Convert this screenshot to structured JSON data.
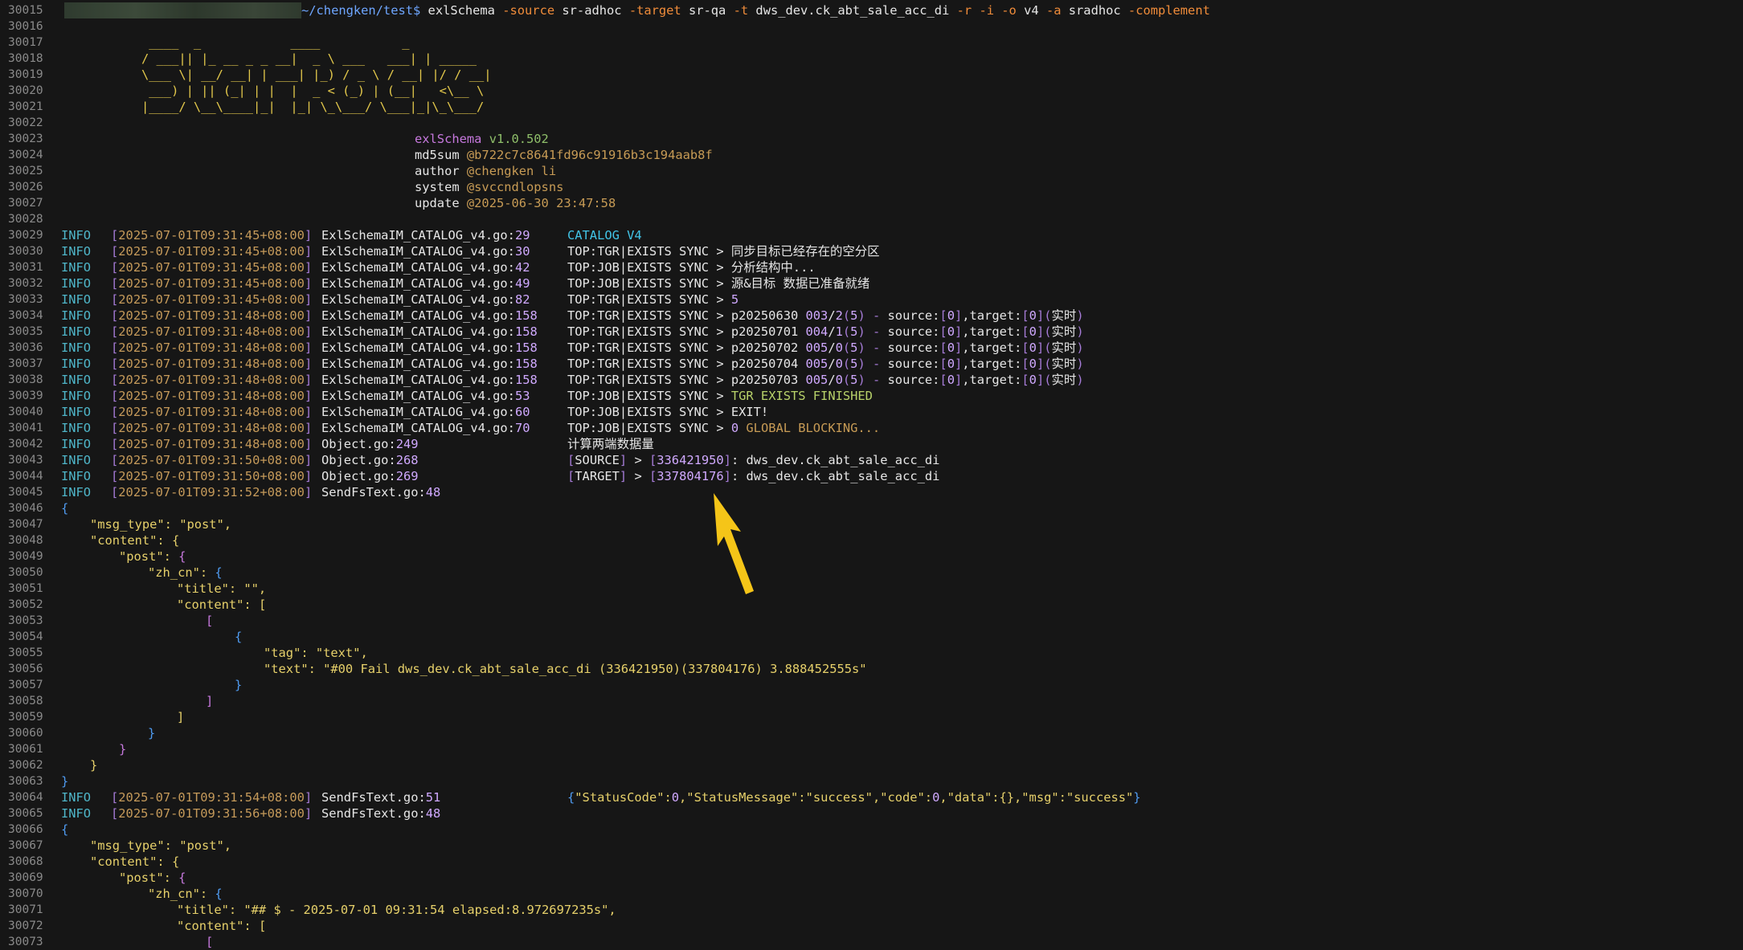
{
  "prompt": {
    "line_no": "30015",
    "path": "~/chengken/test$",
    "command": "exlSchema",
    "args": [
      {
        "t": "-source",
        "k": "flag"
      },
      {
        "t": "sr-adhoc",
        "k": "cmd"
      },
      {
        "t": "-target",
        "k": "flag"
      },
      {
        "t": "sr-qa",
        "k": "cmd"
      },
      {
        "t": "-t",
        "k": "flag"
      },
      {
        "t": "dws_dev.ck_abt_sale_acc_di",
        "k": "cmd"
      },
      {
        "t": "-r",
        "k": "flag"
      },
      {
        "t": "-i",
        "k": "flag"
      },
      {
        "t": "-o",
        "k": "flag"
      },
      {
        "t": "v4",
        "k": "cmd"
      },
      {
        "t": "-a",
        "k": "flag"
      },
      {
        "t": "sradhoc",
        "k": "cmd"
      },
      {
        "t": "-complement",
        "k": "flag"
      }
    ]
  },
  "banner": [
    {
      "n": "30017",
      "t": " ____  _            ____           _"
    },
    {
      "n": "30018",
      "t": "/ ___|| |_ __ _ _ __|  _ \\ ___   ___| | _____"
    },
    {
      "n": "30019",
      "t": "\\___ \\| __/ __| | ___| |_) / _ \\ / __| |/ / __|"
    },
    {
      "n": "30020",
      "t": " ___) | || (_| | |  |  _ < (_) | (__|   <\\__ \\"
    },
    {
      "n": "30021",
      "t": "|____/ \\__\\____|_|  |_| \\_\\___/ \\___|_|\\_\\___/"
    }
  ],
  "meta": [
    {
      "n": "30023",
      "k": "exlSchema",
      "v": "v1.0.502",
      "vc": "vgreen",
      "kc": "vpurple"
    },
    {
      "n": "30024",
      "k": "md5sum",
      "v": "@b722c7c8641fd96c91916b3c194aab8f",
      "vc": "vbrown",
      "kc": "k"
    },
    {
      "n": "30025",
      "k": "author",
      "v": "@chengken li",
      "vc": "vbrown",
      "kc": "k"
    },
    {
      "n": "30026",
      "k": "system",
      "v": "@svccndlopsns",
      "vc": "vbrown",
      "kc": "k"
    },
    {
      "n": "30027",
      "k": "update",
      "v": "@2025-06-30 23:47:58",
      "vc": "vbrown",
      "kc": "k"
    }
  ],
  "logs": [
    {
      "n": "30029",
      "ts": "2025-07-01T09:31:45+08:00",
      "file": "ExlSchemaIM_CATALOG_v4.go",
      "line": "29",
      "msg": [
        {
          "t": "CATALOG V4",
          "k": "cyan"
        }
      ]
    },
    {
      "n": "30030",
      "ts": "2025-07-01T09:31:45+08:00",
      "file": "ExlSchemaIM_CATALOG_v4.go",
      "line": "30",
      "msg": [
        {
          "t": "TOP:TGR|EXISTS SYNC > 同步目标已经存在的空分区",
          "k": "msg"
        }
      ]
    },
    {
      "n": "30031",
      "ts": "2025-07-01T09:31:45+08:00",
      "file": "ExlSchemaIM_CATALOG_v4.go",
      "line": "42",
      "msg": [
        {
          "t": "TOP:JOB|EXISTS SYNC > 分析结构中...",
          "k": "msg"
        }
      ]
    },
    {
      "n": "30032",
      "ts": "2025-07-01T09:31:45+08:00",
      "file": "ExlSchemaIM_CATALOG_v4.go",
      "line": "49",
      "msg": [
        {
          "t": "TOP:JOB|EXISTS SYNC > 源&目标 数据已准备就绪",
          "k": "msg"
        }
      ]
    },
    {
      "n": "30033",
      "ts": "2025-07-01T09:31:45+08:00",
      "file": "ExlSchemaIM_CATALOG_v4.go",
      "line": "82",
      "msg": [
        {
          "t": "TOP:TGR|EXISTS SYNC > ",
          "k": "msg"
        },
        {
          "t": "5",
          "k": "num"
        }
      ]
    },
    {
      "n": "30034",
      "ts": "2025-07-01T09:31:48+08:00",
      "file": "ExlSchemaIM_CATALOG_v4.go",
      "line": "158",
      "msg": [
        {
          "t": "TOP:TGR|EXISTS SYNC > p20250630 ",
          "k": "msg"
        },
        {
          "t": "003",
          "k": "num"
        },
        {
          "t": "/",
          "k": "msg"
        },
        {
          "t": "2",
          "k": "num"
        },
        {
          "t": "(",
          "k": "brkt"
        },
        {
          "t": "5",
          "k": "num"
        },
        {
          "t": ") - ",
          "k": "brkt"
        },
        {
          "t": "source:",
          "k": "msg"
        },
        {
          "t": "[",
          "k": "brkt"
        },
        {
          "t": "0",
          "k": "num"
        },
        {
          "t": "]",
          "k": "brkt"
        },
        {
          "t": ",target:",
          "k": "msg"
        },
        {
          "t": "[",
          "k": "brkt"
        },
        {
          "t": "0",
          "k": "num"
        },
        {
          "t": "]",
          "k": "brkt"
        },
        {
          "t": "(",
          "k": "brkt"
        },
        {
          "t": "实时",
          "k": "msg"
        },
        {
          "t": ")",
          "k": "brkt"
        }
      ]
    },
    {
      "n": "30035",
      "ts": "2025-07-01T09:31:48+08:00",
      "file": "ExlSchemaIM_CATALOG_v4.go",
      "line": "158",
      "msg": [
        {
          "t": "TOP:TGR|EXISTS SYNC > p20250701 ",
          "k": "msg"
        },
        {
          "t": "004",
          "k": "num"
        },
        {
          "t": "/",
          "k": "msg"
        },
        {
          "t": "1",
          "k": "num"
        },
        {
          "t": "(",
          "k": "brkt"
        },
        {
          "t": "5",
          "k": "num"
        },
        {
          "t": ") - ",
          "k": "brkt"
        },
        {
          "t": "source:",
          "k": "msg"
        },
        {
          "t": "[",
          "k": "brkt"
        },
        {
          "t": "0",
          "k": "num"
        },
        {
          "t": "]",
          "k": "brkt"
        },
        {
          "t": ",target:",
          "k": "msg"
        },
        {
          "t": "[",
          "k": "brkt"
        },
        {
          "t": "0",
          "k": "num"
        },
        {
          "t": "]",
          "k": "brkt"
        },
        {
          "t": "(",
          "k": "brkt"
        },
        {
          "t": "实时",
          "k": "msg"
        },
        {
          "t": ")",
          "k": "brkt"
        }
      ]
    },
    {
      "n": "30036",
      "ts": "2025-07-01T09:31:48+08:00",
      "file": "ExlSchemaIM_CATALOG_v4.go",
      "line": "158",
      "msg": [
        {
          "t": "TOP:TGR|EXISTS SYNC > p20250702 ",
          "k": "msg"
        },
        {
          "t": "005",
          "k": "num"
        },
        {
          "t": "/",
          "k": "msg"
        },
        {
          "t": "0",
          "k": "num"
        },
        {
          "t": "(",
          "k": "brkt"
        },
        {
          "t": "5",
          "k": "num"
        },
        {
          "t": ") - ",
          "k": "brkt"
        },
        {
          "t": "source:",
          "k": "msg"
        },
        {
          "t": "[",
          "k": "brkt"
        },
        {
          "t": "0",
          "k": "num"
        },
        {
          "t": "]",
          "k": "brkt"
        },
        {
          "t": ",target:",
          "k": "msg"
        },
        {
          "t": "[",
          "k": "brkt"
        },
        {
          "t": "0",
          "k": "num"
        },
        {
          "t": "]",
          "k": "brkt"
        },
        {
          "t": "(",
          "k": "brkt"
        },
        {
          "t": "实时",
          "k": "msg"
        },
        {
          "t": ")",
          "k": "brkt"
        }
      ]
    },
    {
      "n": "30037",
      "ts": "2025-07-01T09:31:48+08:00",
      "file": "ExlSchemaIM_CATALOG_v4.go",
      "line": "158",
      "msg": [
        {
          "t": "TOP:TGR|EXISTS SYNC > p20250704 ",
          "k": "msg"
        },
        {
          "t": "005",
          "k": "num"
        },
        {
          "t": "/",
          "k": "msg"
        },
        {
          "t": "0",
          "k": "num"
        },
        {
          "t": "(",
          "k": "brkt"
        },
        {
          "t": "5",
          "k": "num"
        },
        {
          "t": ") - ",
          "k": "brkt"
        },
        {
          "t": "source:",
          "k": "msg"
        },
        {
          "t": "[",
          "k": "brkt"
        },
        {
          "t": "0",
          "k": "num"
        },
        {
          "t": "]",
          "k": "brkt"
        },
        {
          "t": ",target:",
          "k": "msg"
        },
        {
          "t": "[",
          "k": "brkt"
        },
        {
          "t": "0",
          "k": "num"
        },
        {
          "t": "]",
          "k": "brkt"
        },
        {
          "t": "(",
          "k": "brkt"
        },
        {
          "t": "实时",
          "k": "msg"
        },
        {
          "t": ")",
          "k": "brkt"
        }
      ]
    },
    {
      "n": "30038",
      "ts": "2025-07-01T09:31:48+08:00",
      "file": "ExlSchemaIM_CATALOG_v4.go",
      "line": "158",
      "msg": [
        {
          "t": "TOP:TGR|EXISTS SYNC > p20250703 ",
          "k": "msg"
        },
        {
          "t": "005",
          "k": "num"
        },
        {
          "t": "/",
          "k": "msg"
        },
        {
          "t": "0",
          "k": "num"
        },
        {
          "t": "(",
          "k": "brkt"
        },
        {
          "t": "5",
          "k": "num"
        },
        {
          "t": ") - ",
          "k": "brkt"
        },
        {
          "t": "source:",
          "k": "msg"
        },
        {
          "t": "[",
          "k": "brkt"
        },
        {
          "t": "0",
          "k": "num"
        },
        {
          "t": "]",
          "k": "brkt"
        },
        {
          "t": ",target:",
          "k": "msg"
        },
        {
          "t": "[",
          "k": "brkt"
        },
        {
          "t": "0",
          "k": "num"
        },
        {
          "t": "]",
          "k": "brkt"
        },
        {
          "t": "(",
          "k": "brkt"
        },
        {
          "t": "实时",
          "k": "msg"
        },
        {
          "t": ")",
          "k": "brkt"
        }
      ]
    },
    {
      "n": "30039",
      "ts": "2025-07-01T09:31:48+08:00",
      "file": "ExlSchemaIM_CATALOG_v4.go",
      "line": "53",
      "msg": [
        {
          "t": "TOP:JOB|EXISTS SYNC > ",
          "k": "msg"
        },
        {
          "t": "TGR EXISTS FINISHED",
          "k": "lime"
        }
      ]
    },
    {
      "n": "30040",
      "ts": "2025-07-01T09:31:48+08:00",
      "file": "ExlSchemaIM_CATALOG_v4.go",
      "line": "60",
      "msg": [
        {
          "t": "TOP:JOB|EXISTS SYNC > EXIT!",
          "k": "msg"
        }
      ]
    },
    {
      "n": "30041",
      "ts": "2025-07-01T09:31:48+08:00",
      "file": "ExlSchemaIM_CATALOG_v4.go",
      "line": "70",
      "msg": [
        {
          "t": "TOP:JOB|EXISTS SYNC > ",
          "k": "msg"
        },
        {
          "t": "0",
          "k": "num"
        },
        {
          "t": " GLOBAL BLOCKING...",
          "k": "orange"
        }
      ]
    },
    {
      "n": "30042",
      "ts": "2025-07-01T09:31:48+08:00",
      "file": "Object.go",
      "line": "249",
      "msg": [
        {
          "t": "计算两端数据量",
          "k": "msg"
        }
      ]
    },
    {
      "n": "30043",
      "ts": "2025-07-01T09:31:50+08:00",
      "file": "Object.go",
      "line": "268",
      "msg": [
        {
          "t": "[",
          "k": "brkt"
        },
        {
          "t": "SOURCE",
          "k": "msg"
        },
        {
          "t": "]",
          "k": "brkt"
        },
        {
          "t": " > ",
          "k": "msg"
        },
        {
          "t": "[",
          "k": "brkt"
        },
        {
          "t": "336421950",
          "k": "num"
        },
        {
          "t": "]",
          "k": "brkt"
        },
        {
          "t": ": dws_dev.ck_abt_sale_acc_di",
          "k": "msg"
        }
      ]
    },
    {
      "n": "30044",
      "ts": "2025-07-01T09:31:50+08:00",
      "file": "Object.go",
      "line": "269",
      "msg": [
        {
          "t": "[",
          "k": "brkt"
        },
        {
          "t": "TARGET",
          "k": "msg"
        },
        {
          "t": "]",
          "k": "brkt"
        },
        {
          "t": " > ",
          "k": "msg"
        },
        {
          "t": "[",
          "k": "brkt"
        },
        {
          "t": "337804176",
          "k": "num"
        },
        {
          "t": "]",
          "k": "brkt"
        },
        {
          "t": ": dws_dev.ck_abt_sale_acc_di",
          "k": "msg"
        }
      ]
    },
    {
      "n": "30045",
      "ts": "2025-07-01T09:31:52+08:00",
      "file": "SendFsText.go",
      "line": "48",
      "msg": []
    }
  ],
  "json1": [
    {
      "n": "30046",
      "i": 0,
      "parts": [
        {
          "t": "{",
          "k": "jp3"
        }
      ]
    },
    {
      "n": "30047",
      "i": 1,
      "parts": [
        {
          "t": "\"msg_type\": \"post\",",
          "k": "jkey"
        }
      ]
    },
    {
      "n": "30048",
      "i": 1,
      "parts": [
        {
          "t": "\"content\": ",
          "k": "jkey"
        },
        {
          "t": "{",
          "k": "jp1"
        }
      ]
    },
    {
      "n": "30049",
      "i": 2,
      "parts": [
        {
          "t": "\"post\": ",
          "k": "jkey"
        },
        {
          "t": "{",
          "k": "jp2"
        }
      ]
    },
    {
      "n": "30050",
      "i": 3,
      "parts": [
        {
          "t": "\"zh_cn\": ",
          "k": "jkey"
        },
        {
          "t": "{",
          "k": "jp3"
        }
      ]
    },
    {
      "n": "30051",
      "i": 4,
      "parts": [
        {
          "t": "\"title\": \"\",",
          "k": "jkey"
        }
      ]
    },
    {
      "n": "30052",
      "i": 4,
      "parts": [
        {
          "t": "\"content\": ",
          "k": "jkey"
        },
        {
          "t": "[",
          "k": "jp1"
        }
      ]
    },
    {
      "n": "30053",
      "i": 5,
      "parts": [
        {
          "t": "[",
          "k": "jp2"
        }
      ]
    },
    {
      "n": "30054",
      "i": 6,
      "parts": [
        {
          "t": "{",
          "k": "jp3"
        }
      ]
    },
    {
      "n": "30055",
      "i": 7,
      "parts": [
        {
          "t": "\"tag\": \"text\",",
          "k": "jkey"
        }
      ]
    },
    {
      "n": "30056",
      "i": 7,
      "parts": [
        {
          "t": "\"text\": \"#00 Fail dws_dev.ck_abt_sale_acc_di (336421950)(337804176) 3.888452555s\"",
          "k": "jkey"
        }
      ]
    },
    {
      "n": "30057",
      "i": 6,
      "parts": [
        {
          "t": "}",
          "k": "jp3"
        }
      ]
    },
    {
      "n": "30058",
      "i": 5,
      "parts": [
        {
          "t": "]",
          "k": "jp2"
        }
      ]
    },
    {
      "n": "30059",
      "i": 4,
      "parts": [
        {
          "t": "]",
          "k": "jp1"
        }
      ]
    },
    {
      "n": "30060",
      "i": 3,
      "parts": [
        {
          "t": "}",
          "k": "jp3"
        }
      ]
    },
    {
      "n": "30061",
      "i": 2,
      "parts": [
        {
          "t": "}",
          "k": "jp2"
        }
      ]
    },
    {
      "n": "30062",
      "i": 1,
      "parts": [
        {
          "t": "}",
          "k": "jp1"
        }
      ]
    },
    {
      "n": "30063",
      "i": 0,
      "parts": [
        {
          "t": "}",
          "k": "jp3"
        }
      ]
    }
  ],
  "logs2": [
    {
      "n": "30064",
      "ts": "2025-07-01T09:31:54+08:00",
      "file": "SendFsText.go",
      "line": "51",
      "msg": [
        {
          "t": "{",
          "k": "jp3"
        },
        {
          "t": "\"StatusCode\":",
          "k": "jkey"
        },
        {
          "t": "0",
          "k": "num"
        },
        {
          "t": ",\"StatusMessage\":\"success\",\"code\":",
          "k": "jkey"
        },
        {
          "t": "0",
          "k": "num"
        },
        {
          "t": ",\"data\":{},\"msg\":\"success\"",
          "k": "jkey"
        },
        {
          "t": "}",
          "k": "jp3"
        }
      ]
    },
    {
      "n": "30065",
      "ts": "2025-07-01T09:31:56+08:00",
      "file": "SendFsText.go",
      "line": "48",
      "msg": []
    }
  ],
  "json2": [
    {
      "n": "30066",
      "i": 0,
      "parts": [
        {
          "t": "{",
          "k": "jp3"
        }
      ]
    },
    {
      "n": "30067",
      "i": 1,
      "parts": [
        {
          "t": "\"msg_type\": \"post\",",
          "k": "jkey"
        }
      ]
    },
    {
      "n": "30068",
      "i": 1,
      "parts": [
        {
          "t": "\"content\": ",
          "k": "jkey"
        },
        {
          "t": "{",
          "k": "jp1"
        }
      ]
    },
    {
      "n": "30069",
      "i": 2,
      "parts": [
        {
          "t": "\"post\": ",
          "k": "jkey"
        },
        {
          "t": "{",
          "k": "jp2"
        }
      ]
    },
    {
      "n": "30070",
      "i": 3,
      "parts": [
        {
          "t": "\"zh_cn\": ",
          "k": "jkey"
        },
        {
          "t": "{",
          "k": "jp3"
        }
      ]
    },
    {
      "n": "30071",
      "i": 4,
      "parts": [
        {
          "t": "\"title\": \"## $ - 2025-07-01 09:31:54 elapsed:8.972697235s\",",
          "k": "jkey"
        }
      ]
    },
    {
      "n": "30072",
      "i": 4,
      "parts": [
        {
          "t": "\"content\": ",
          "k": "jkey"
        },
        {
          "t": "[",
          "k": "jp1"
        }
      ]
    },
    {
      "n": "30073",
      "i": 5,
      "parts": [
        {
          "t": "[",
          "k": "jp2"
        }
      ]
    }
  ],
  "level": "INFO",
  "blank_lines": [
    "30016",
    "30022",
    "30028"
  ],
  "colors": {
    "background": "#161616",
    "arrow": "#f5c518"
  }
}
